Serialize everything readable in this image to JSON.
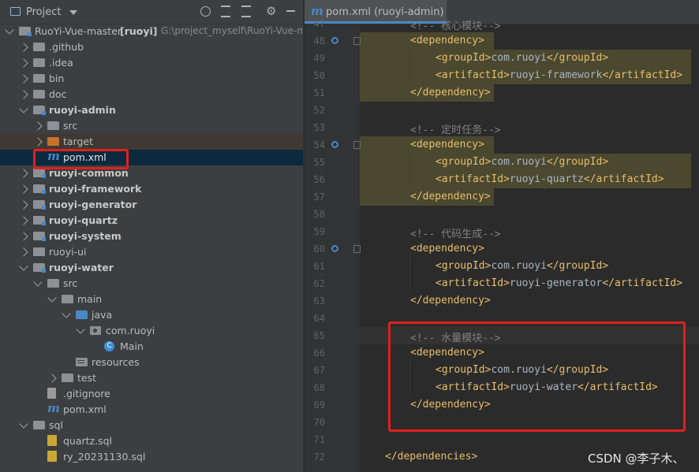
{
  "project_panel": {
    "title": "Project",
    "tree": [
      {
        "label": "RuoYi-Vue-master",
        "bold_suffix": "[ruoyi]",
        "path": "G:\\project_myself\\RuoYi-Vue-ma",
        "depth": 0,
        "icon": "module-folder-icon",
        "expanded": true
      },
      {
        "label": ".github",
        "depth": 1,
        "icon": "folder-icon"
      },
      {
        "label": ".idea",
        "depth": 1,
        "icon": "folder-icon"
      },
      {
        "label": "bin",
        "depth": 1,
        "icon": "folder-icon"
      },
      {
        "label": "doc",
        "depth": 1,
        "icon": "folder-icon"
      },
      {
        "label": "ruoyi-admin",
        "depth": 1,
        "icon": "module-folder-icon",
        "expanded": true,
        "bold": true
      },
      {
        "label": "src",
        "depth": 2,
        "icon": "folder-icon"
      },
      {
        "label": "target",
        "depth": 2,
        "icon": "excluded-folder-icon",
        "excluded": true
      },
      {
        "label": "pom.xml",
        "depth": 2,
        "icon": "maven-icon",
        "selected": true,
        "leaf": true
      },
      {
        "label": "ruoyi-common",
        "depth": 1,
        "icon": "module-folder-icon",
        "bold": true
      },
      {
        "label": "ruoyi-framework",
        "depth": 1,
        "icon": "module-folder-icon",
        "bold": true
      },
      {
        "label": "ruoyi-generator",
        "depth": 1,
        "icon": "module-folder-icon",
        "bold": true
      },
      {
        "label": "ruoyi-quartz",
        "depth": 1,
        "icon": "module-folder-icon",
        "bold": true
      },
      {
        "label": "ruoyi-system",
        "depth": 1,
        "icon": "module-folder-icon",
        "bold": true
      },
      {
        "label": "ruoyi-ui",
        "depth": 1,
        "icon": "folder-icon"
      },
      {
        "label": "ruoyi-water",
        "depth": 1,
        "icon": "module-folder-icon",
        "expanded": true,
        "bold": true
      },
      {
        "label": "src",
        "depth": 2,
        "icon": "folder-icon",
        "expanded": true
      },
      {
        "label": "main",
        "depth": 3,
        "icon": "folder-icon",
        "expanded": true
      },
      {
        "label": "java",
        "depth": 4,
        "icon": "source-folder-icon",
        "expanded": true
      },
      {
        "label": "com.ruoyi",
        "depth": 5,
        "icon": "package-icon",
        "expanded": true
      },
      {
        "label": "Main",
        "depth": 6,
        "icon": "class-icon",
        "leaf": true
      },
      {
        "label": "resources",
        "depth": 4,
        "icon": "resources-folder-icon",
        "leaf": true
      },
      {
        "label": "test",
        "depth": 3,
        "icon": "folder-icon"
      },
      {
        "label": ".gitignore",
        "depth": 2,
        "icon": "gitignore-icon",
        "leaf": true
      },
      {
        "label": "pom.xml",
        "depth": 2,
        "icon": "maven-icon",
        "leaf": true
      },
      {
        "label": "sql",
        "depth": 1,
        "icon": "folder-icon",
        "expanded": true
      },
      {
        "label": "quartz.sql",
        "depth": 2,
        "icon": "sql-file-icon",
        "leaf": true
      },
      {
        "label": "ry_20231130.sql",
        "depth": 2,
        "icon": "sql-file-icon",
        "leaf": true
      }
    ]
  },
  "editor": {
    "tab_title": "pom.xml (ruoyi-admin)",
    "lines": [
      {
        "n": "47",
        "parts": [
          {
            "t": "cmt",
            "v": "<!-- 核心模块-->"
          }
        ],
        "indent": 1
      },
      {
        "n": "48",
        "parts": [
          {
            "t": "tag",
            "v": "<dependency>"
          }
        ],
        "indent": 1,
        "hl": true,
        "mark": true
      },
      {
        "n": "49",
        "parts": [
          {
            "t": "tag",
            "v": "<groupId>"
          },
          {
            "t": "txt",
            "v": "com.ruoyi"
          },
          {
            "t": "tag",
            "v": "</groupId>"
          }
        ],
        "indent": 2,
        "hl": true
      },
      {
        "n": "50",
        "parts": [
          {
            "t": "tag",
            "v": "<artifactId>"
          },
          {
            "t": "txt",
            "v": "ruoyi-framework"
          },
          {
            "t": "tag",
            "v": "</artifactId>"
          }
        ],
        "indent": 2,
        "hl": true
      },
      {
        "n": "51",
        "parts": [
          {
            "t": "tag",
            "v": "</dependency>"
          }
        ],
        "indent": 1,
        "hl": true
      },
      {
        "n": "52",
        "parts": [],
        "indent": 0
      },
      {
        "n": "53",
        "parts": [
          {
            "t": "cmt",
            "v": "<!-- 定时任务-->"
          }
        ],
        "indent": 1
      },
      {
        "n": "54",
        "parts": [
          {
            "t": "tag",
            "v": "<dependency>"
          }
        ],
        "indent": 1,
        "hl": true,
        "mark": true
      },
      {
        "n": "55",
        "parts": [
          {
            "t": "tag",
            "v": "<groupId>"
          },
          {
            "t": "txt",
            "v": "com.ruoyi"
          },
          {
            "t": "tag",
            "v": "</groupId>"
          }
        ],
        "indent": 2,
        "hl": true
      },
      {
        "n": "56",
        "parts": [
          {
            "t": "tag",
            "v": "<artifactId>"
          },
          {
            "t": "txt",
            "v": "ruoyi-quartz"
          },
          {
            "t": "tag",
            "v": "</artifactId>"
          }
        ],
        "indent": 2,
        "hl": true
      },
      {
        "n": "57",
        "parts": [
          {
            "t": "tag",
            "v": "</dependency>"
          }
        ],
        "indent": 1,
        "hl": true
      },
      {
        "n": "58",
        "parts": [],
        "indent": 0
      },
      {
        "n": "59",
        "parts": [
          {
            "t": "cmt",
            "v": "<!-- 代码生成-->"
          }
        ],
        "indent": 1
      },
      {
        "n": "60",
        "parts": [
          {
            "t": "tag",
            "v": "<dependency>"
          }
        ],
        "indent": 1,
        "mark": true
      },
      {
        "n": "61",
        "parts": [
          {
            "t": "tag",
            "v": "<groupId>"
          },
          {
            "t": "txt",
            "v": "com.ruoyi"
          },
          {
            "t": "tag",
            "v": "</groupId>"
          }
        ],
        "indent": 2
      },
      {
        "n": "62",
        "parts": [
          {
            "t": "tag",
            "v": "<artifactId>"
          },
          {
            "t": "txt",
            "v": "ruoyi-generator"
          },
          {
            "t": "tag",
            "v": "</artifactId>"
          }
        ],
        "indent": 2
      },
      {
        "n": "63",
        "parts": [
          {
            "t": "tag",
            "v": "</dependency>"
          }
        ],
        "indent": 1
      },
      {
        "n": "64",
        "parts": [],
        "indent": 0
      },
      {
        "n": "65",
        "parts": [
          {
            "t": "cmt",
            "v": "<!-- 水量模块-->"
          }
        ],
        "indent": 1,
        "current": true
      },
      {
        "n": "66",
        "parts": [
          {
            "t": "tag",
            "v": "<dependency>"
          }
        ],
        "indent": 1
      },
      {
        "n": "67",
        "parts": [
          {
            "t": "tag",
            "v": "<groupId>"
          },
          {
            "t": "txt",
            "v": "com.ruoyi"
          },
          {
            "t": "tag",
            "v": "</groupId>"
          }
        ],
        "indent": 2
      },
      {
        "n": "68",
        "parts": [
          {
            "t": "tag",
            "v": "<artifactId>"
          },
          {
            "t": "txt",
            "v": "ruoyi-water"
          },
          {
            "t": "tag",
            "v": "</artifactId>"
          }
        ],
        "indent": 2
      },
      {
        "n": "69",
        "parts": [
          {
            "t": "tag",
            "v": "</dependency>"
          }
        ],
        "indent": 1
      },
      {
        "n": "70",
        "parts": [],
        "indent": 0
      },
      {
        "n": "71",
        "parts": [],
        "indent": 0
      },
      {
        "n": "72",
        "parts": [
          {
            "t": "tag",
            "v": "</dependencies>"
          }
        ],
        "indent": 0
      }
    ]
  },
  "watermark": "CSDN @李子木、"
}
